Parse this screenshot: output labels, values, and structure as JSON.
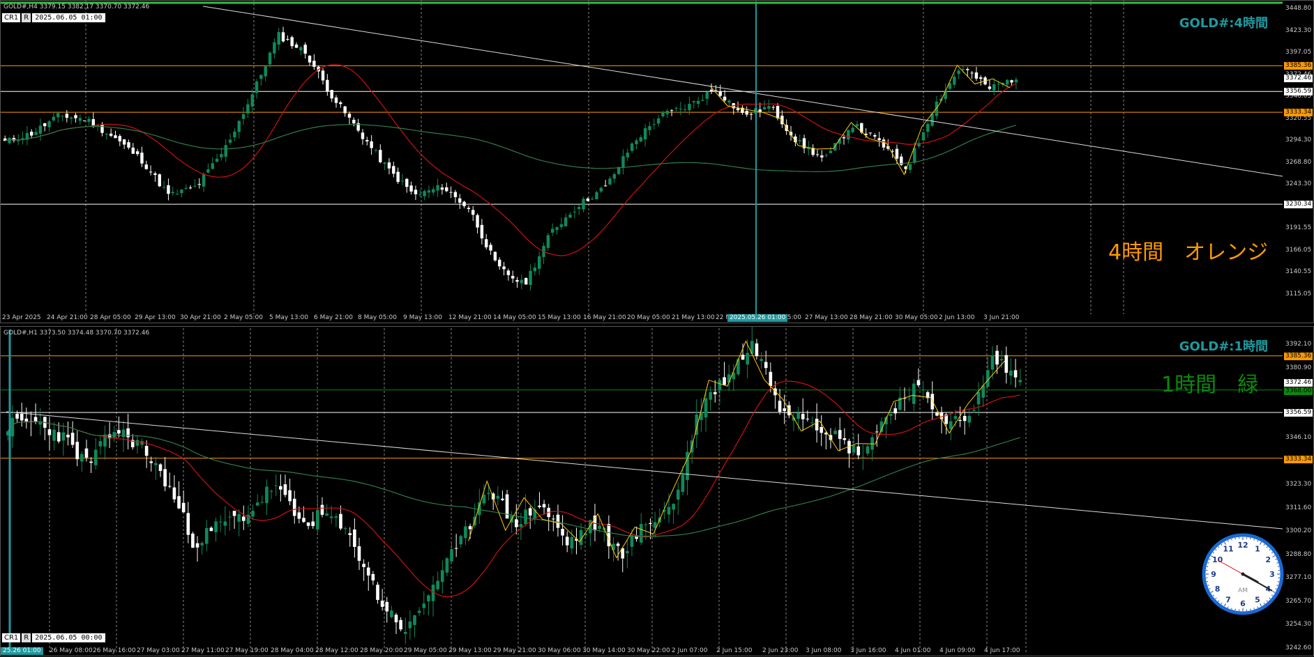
{
  "top": {
    "header": "GOLD#,H4  3379.15 3382.17 3370.70 3372.46",
    "cr_tag": "CR1",
    "r_tag": "R",
    "datetime": "2025.06.05 01:00",
    "title": "GOLD#:4時間",
    "note": "4時間　オレンジ",
    "highlight_date": "2025.05.26 01:00",
    "x_labels": [
      "23 Apr 2025",
      "24 Apr 21:00",
      "28 Apr 05:00",
      "29 Apr 13:00",
      "30 Apr 21:00",
      "2 May 05:00",
      "5 May 13:00",
      "6 May 21:00",
      "8 May 05:00",
      "9 May 13:00",
      "12 May 21:00",
      "14 May 05:00",
      "15 May 13:00",
      "16 May 21:00",
      "20 May 05:00",
      "21 May 13:00",
      "22 M",
      "05:00",
      "27 May 13:00",
      "28 May 21:00",
      "30 May 05:00",
      "2 Jun 13:00",
      "3 Jun 21:00"
    ],
    "y_labels": [
      "3448.80",
      "3423.30",
      "3397.05",
      "3372.46",
      "3346.05",
      "3320.55",
      "3294.30",
      "3268.80",
      "3243.30",
      "3217.80",
      "3191.55",
      "3166.05",
      "3140.55",
      "3115.05"
    ],
    "price_tags": [
      {
        "label": "3385.36",
        "color": "#ff9900"
      },
      {
        "label": "3372.46",
        "color": "#ffffff"
      },
      {
        "label": "3356.59",
        "color": "#ffffff"
      },
      {
        "label": "3333.34",
        "color": "#ff9900"
      },
      {
        "label": "3230.34",
        "color": "#ffffff"
      }
    ]
  },
  "bottom": {
    "header": "GOLD#,H1  3373.50 3374.48 3370.70 3372.46",
    "cr_tag": "CR1",
    "r_tag": "R",
    "datetime": "2025.06.05 00:00",
    "title": "GOLD#:1時間",
    "note": "1時間　緑",
    "highlight_date": "25.26 01:00",
    "x_labels": [
      "S",
      "26 May 08:00",
      "26 May 16:00",
      "27 May 03:00",
      "27 May 11:00",
      "27 May 19:00",
      "28 May 04:00",
      "28 May 12:00",
      "28 May 20:00",
      "29 May 05:00",
      "29 May 13:00",
      "29 May 21:00",
      "30 May 06:00",
      "30 May 14:00",
      "30 May 22:00",
      "2 Jun 07:00",
      "2 Jun 15:00",
      "2 Jun 23:00",
      "3 Jun 08:00",
      "3 Jun 16:00",
      "4 Jun 01:00",
      "4 Jun 09:00",
      "4 Jun 17:00"
    ],
    "y_labels": [
      "3392.10",
      "3380.90",
      "3369.75",
      "3358.55",
      "3346.10",
      "3334.90",
      "3323.30",
      "3311.60",
      "3300.20",
      "3288.80",
      "3277.10",
      "3265.70",
      "3254.30",
      "3242.60"
    ],
    "price_tags": [
      {
        "label": "3385.36",
        "color": "#ff9900"
      },
      {
        "label": "3372.46",
        "color": "#ffffff"
      },
      {
        "label": "3368.00",
        "color": "#0a8a0a"
      },
      {
        "label": "3356.59",
        "color": "#ffffff"
      },
      {
        "label": "3333.34",
        "color": "#ff9900"
      }
    ]
  },
  "clock": {
    "label": "AM",
    "hours": [
      "12",
      "1",
      "2",
      "3",
      "4",
      "5",
      "6",
      "7",
      "8",
      "9",
      "10",
      "11"
    ]
  },
  "colors": {
    "bull": "#0e8a5a",
    "bear": "#ffffff",
    "orange": "#ff9900",
    "teal": "#1e9aa0",
    "green": "#0a8a0a",
    "red": "#d01010",
    "ma_green": "#2e7d4a"
  }
}
